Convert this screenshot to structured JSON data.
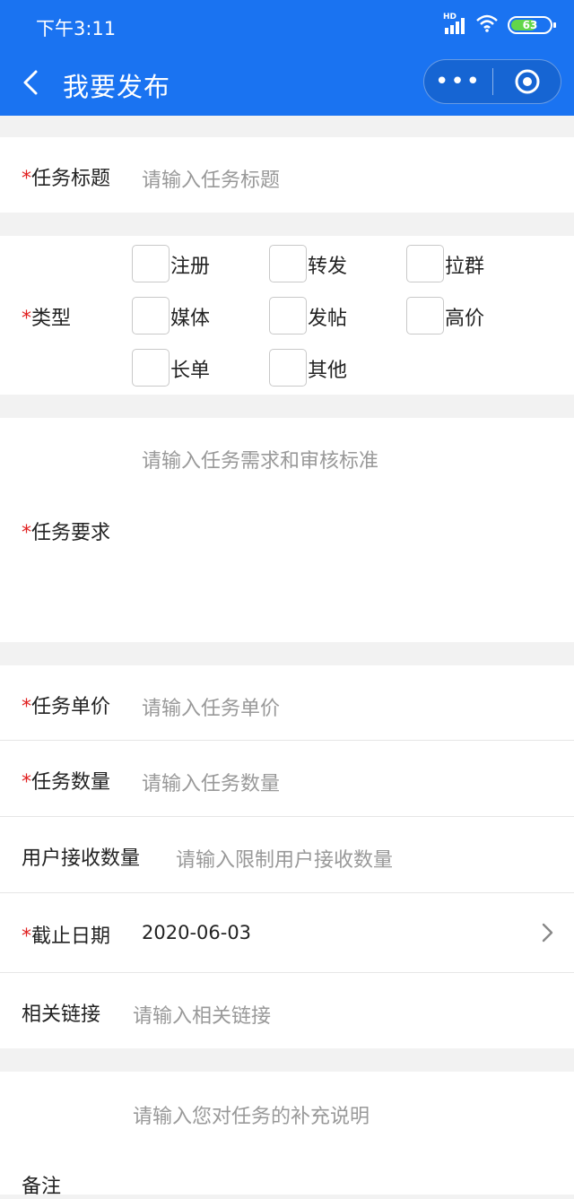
{
  "status_bar": {
    "time": "下午3:11",
    "battery": "63",
    "signal_label": "HD"
  },
  "nav": {
    "title": "我要发布",
    "more_label": "•••"
  },
  "form": {
    "required_mark": "*",
    "title_label": "任务标题",
    "title_placeholder": "请输入任务标题",
    "type_label": "类型",
    "types": [
      "注册",
      "转发",
      "拉群",
      "媒体",
      "发帖",
      "高价",
      "长单",
      "其他"
    ],
    "requirement_label": "任务要求",
    "requirement_placeholder": "请输入任务需求和审核标准",
    "price_label": "任务单价",
    "price_placeholder": "请输入任务单价",
    "quantity_label": "任务数量",
    "quantity_placeholder": "请输入任务数量",
    "user_quota_label": "用户接收数量",
    "user_quota_placeholder": "请输入限制用户接收数量",
    "deadline_label": "截止日期",
    "deadline_value": "2020-06-03",
    "link_label": "相关链接",
    "link_placeholder": "请输入相关链接",
    "remark_label": "备注",
    "remark_placeholder": "请输入您对任务的补充说明"
  },
  "colors": {
    "header": "#1a73f1",
    "required": "#e02020",
    "placeholder": "#999999",
    "battery": "#62d64a"
  }
}
